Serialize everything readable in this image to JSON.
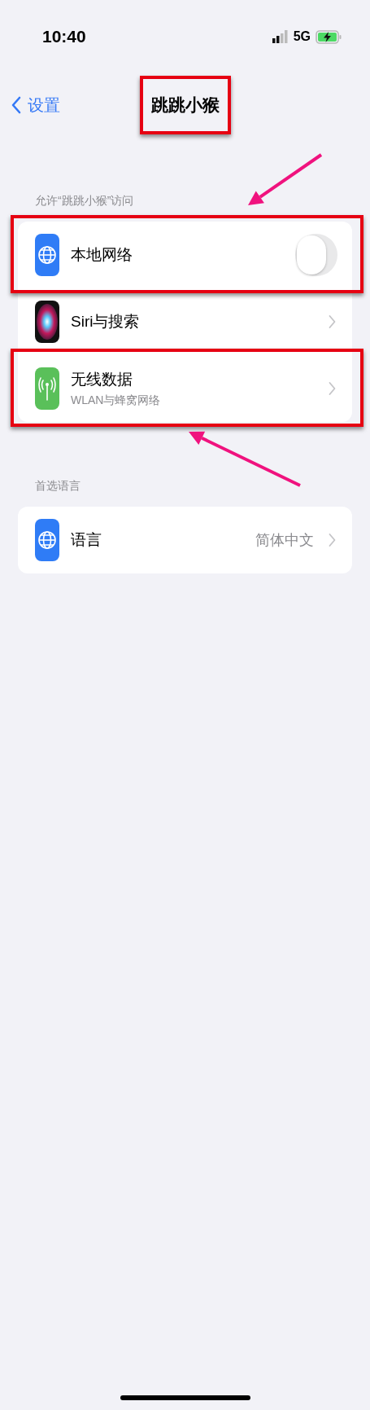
{
  "status_bar": {
    "time": "10:40",
    "network": "5G"
  },
  "nav": {
    "back": "设置",
    "title": "跳跳小猴",
    "highlighted": true
  },
  "sections": [
    {
      "header": "允许“跳跳小猴”访问",
      "rows": [
        {
          "kind": "toggle",
          "label": "本地网络",
          "on": false,
          "highlighted": true,
          "arrow": true
        },
        {
          "kind": "link",
          "label": "Siri与搜索",
          "highlighted": false
        },
        {
          "kind": "link",
          "label": "无线数据",
          "sublabel": "WLAN与蜂窝网络",
          "highlighted": true,
          "arrow": true
        }
      ]
    },
    {
      "header": "首选语言",
      "rows": [
        {
          "kind": "link",
          "label": "语言",
          "value": "简体中文",
          "highlighted": false
        }
      ]
    }
  ]
}
